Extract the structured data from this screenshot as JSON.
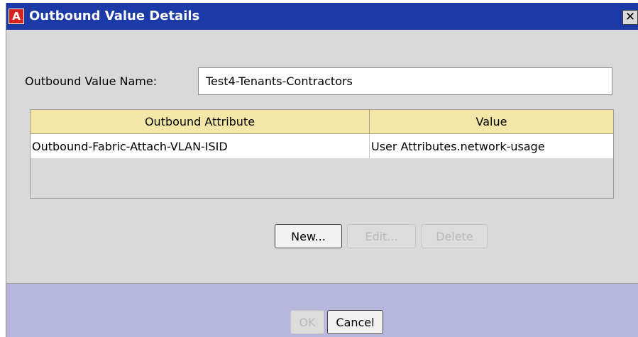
{
  "window": {
    "title": "Outbound Value Details",
    "icon_letter": "A",
    "close_glyph": "✕"
  },
  "form": {
    "name_label": "Outbound Value Name:",
    "name_value": "Test4-Tenants-Contractors"
  },
  "table": {
    "columns": [
      "Outbound Attribute",
      "Value"
    ],
    "rows": [
      [
        "Outbound-Fabric-Attach-VLAN-ISID",
        "User Attributes.network-usage"
      ]
    ]
  },
  "table_buttons": {
    "new": "New...",
    "edit": "Edit...",
    "delete": "Delete"
  },
  "footer_buttons": {
    "ok": "OK",
    "cancel": "Cancel"
  },
  "colors": {
    "titlebar": "#1b3aa8",
    "dialog_bg": "#d9d9d9",
    "table_header": "#f3e7a8",
    "footer_bg": "#b7b7de",
    "app_icon": "#d6231e"
  }
}
